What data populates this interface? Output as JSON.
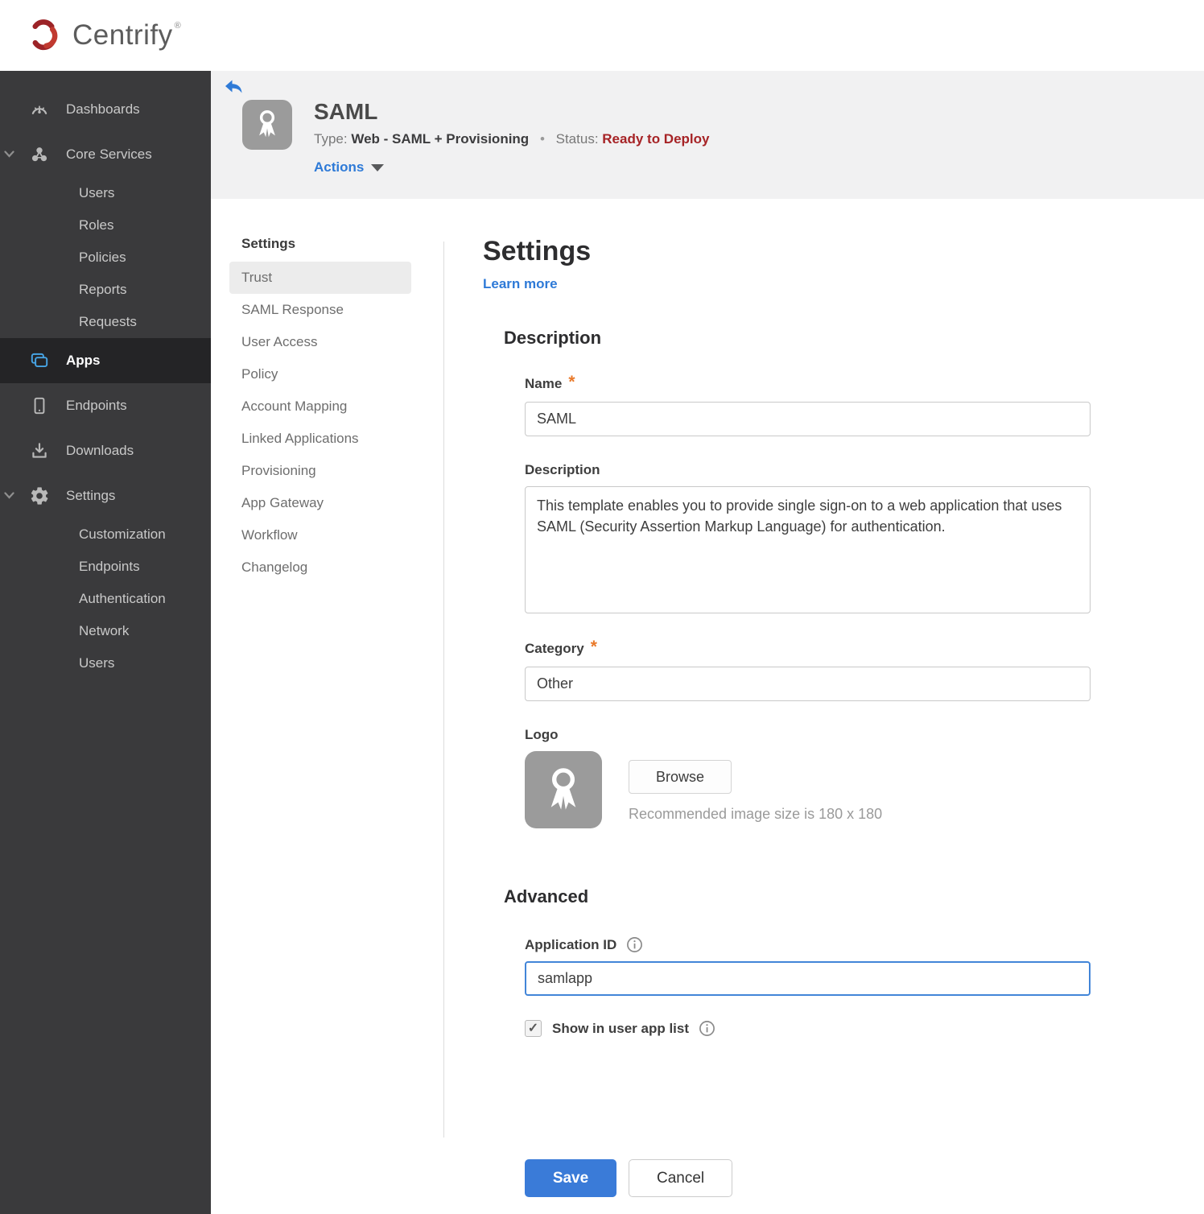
{
  "topbar": {
    "brand": "Centrify",
    "registered": "®"
  },
  "sidebar": {
    "items": [
      {
        "label": "Dashboards",
        "icon": "gauge-icon",
        "level": 0
      },
      {
        "label": "Core Services",
        "icon": "core-services-icon",
        "level": 0,
        "expanded": true
      },
      {
        "label": "Users",
        "level": 1
      },
      {
        "label": "Roles",
        "level": 1
      },
      {
        "label": "Policies",
        "level": 1
      },
      {
        "label": "Reports",
        "level": 1
      },
      {
        "label": "Requests",
        "level": 1
      },
      {
        "label": "Apps",
        "icon": "apps-icon",
        "level": 0,
        "selected": true
      },
      {
        "label": "Endpoints",
        "icon": "mobile-icon",
        "level": 0
      },
      {
        "label": "Downloads",
        "icon": "download-icon",
        "level": 0
      },
      {
        "label": "Settings",
        "icon": "gear-icon",
        "level": 0,
        "expanded": true
      },
      {
        "label": "Customization",
        "level": 1
      },
      {
        "label": "Endpoints",
        "level": 1
      },
      {
        "label": "Authentication",
        "level": 1
      },
      {
        "label": "Network",
        "level": 1
      },
      {
        "label": "Users",
        "level": 1
      }
    ]
  },
  "app_header": {
    "title": "SAML",
    "type_label": "Type:",
    "type_value": "Web - SAML + Provisioning",
    "separator": "•",
    "status_label": "Status:",
    "status_value": "Ready to Deploy",
    "actions_label": "Actions"
  },
  "subnav": {
    "header": "Settings",
    "selected": "Trust",
    "items": [
      {
        "label": "Trust",
        "selected": true
      },
      {
        "label": "SAML Response"
      },
      {
        "label": "User Access"
      },
      {
        "label": "Policy"
      },
      {
        "label": "Account Mapping"
      },
      {
        "label": "Linked Applications"
      },
      {
        "label": "Provisioning"
      },
      {
        "label": "App Gateway"
      },
      {
        "label": "Workflow"
      },
      {
        "label": "Changelog"
      }
    ]
  },
  "main": {
    "title": "Settings",
    "learn_more": "Learn more",
    "description": {
      "heading": "Description",
      "name_label": "Name",
      "required_mark": "*",
      "name_value": "SAML",
      "desc_label": "Description",
      "desc_value": "This template enables you to provide single sign-on to a web application that uses SAML (Security Assertion Markup Language) for authentication.",
      "category_label": "Category",
      "category_value": "Other",
      "logo_label": "Logo",
      "browse_label": "Browse",
      "recommended_text": "Recommended image size is 180 x 180"
    },
    "advanced": {
      "heading": "Advanced",
      "app_id_label": "Application ID",
      "app_id_value": "samlapp",
      "app_id_focused": true,
      "show_label": "Show in user app list",
      "checkbox_checked": true
    },
    "actions": {
      "save": "Save",
      "cancel": "Cancel"
    }
  },
  "colors": {
    "sidebar_bg": "#3a3a3c",
    "sidebar_selected_bg": "#242426",
    "header_bg": "#f1f1f2",
    "accent_blue": "#2e7ad7",
    "apps_icon_blue": "#47a4e4",
    "status_red": "#a62326",
    "asterisk_orange": "#e97a2b",
    "save_button_blue": "#3a7bd8",
    "focus_border_blue": "#4285d8",
    "brand_red_dark": "#9c2327",
    "brand_red_light": "#c13a30"
  }
}
